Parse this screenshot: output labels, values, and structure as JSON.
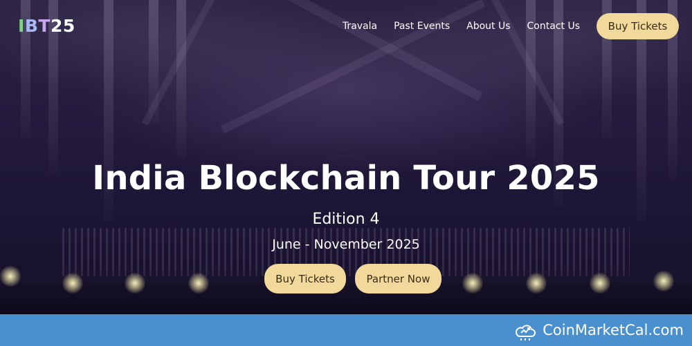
{
  "header": {
    "logo": {
      "letters": [
        {
          "text": "I",
          "color": "#7fd48a"
        },
        {
          "text": "B",
          "color": "#a8b8f5"
        },
        {
          "text": "T",
          "color": "#c9a6f0"
        },
        {
          "text": "25",
          "color": "#ffffff"
        }
      ]
    },
    "nav": {
      "links": [
        "Travala",
        "Past Events",
        "About Us",
        "Contact Us"
      ],
      "button_label": "Buy Tickets"
    }
  },
  "hero": {
    "title": "India Blockchain Tour 2025",
    "edition": "Edition 4",
    "dates": "June - November 2025",
    "buttons": {
      "buy_label": "Buy Tickets",
      "partner_label": "Partner Now"
    }
  },
  "footer": {
    "watermark_text": "CoinMarketCal.com",
    "watermark_icon": "chart-cloud-icon"
  },
  "colors": {
    "accent_button": "#f0d99a",
    "footer_bar": "#4a8fce",
    "hero_bg": "#241a3d"
  }
}
